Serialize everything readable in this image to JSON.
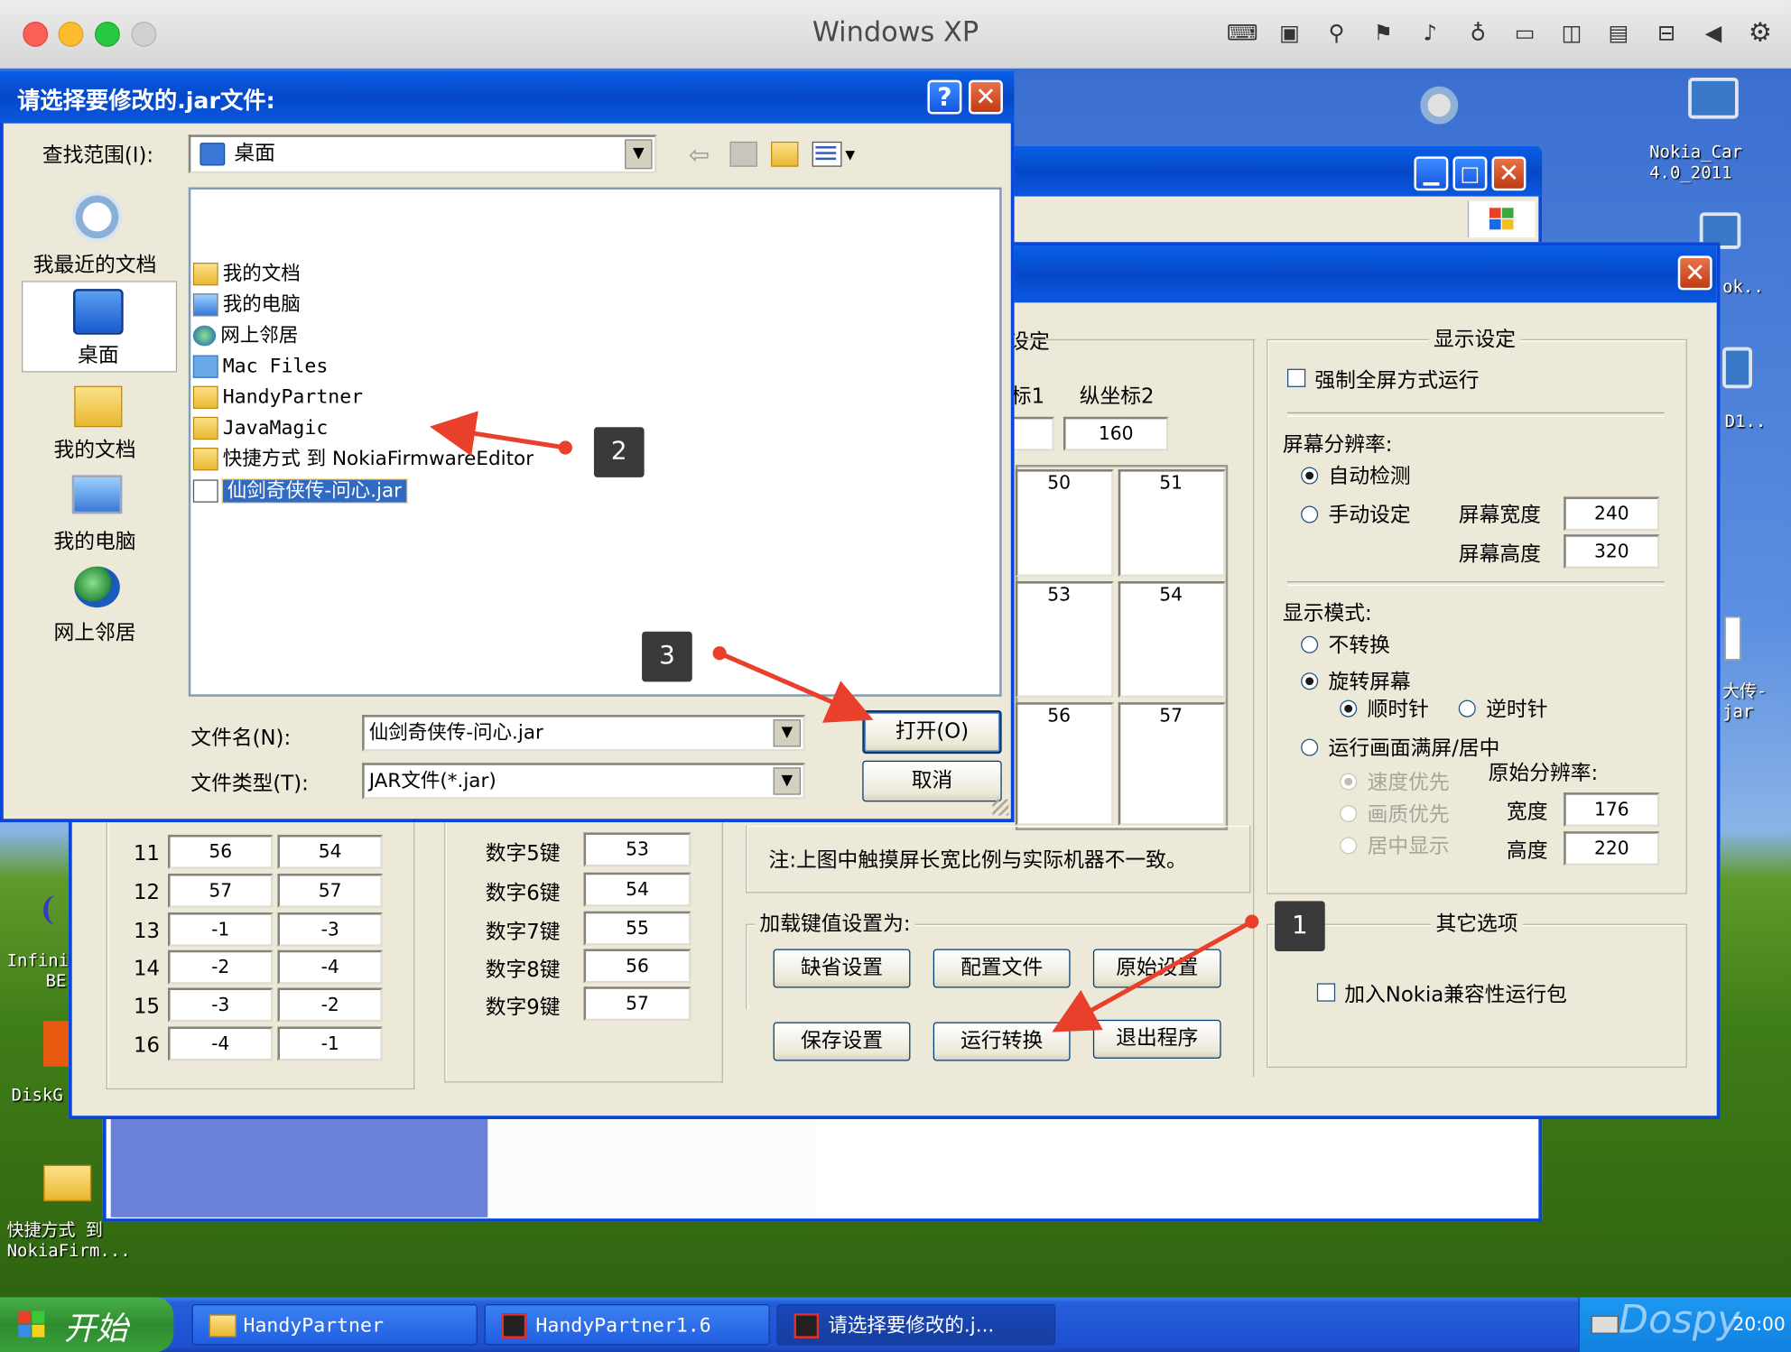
{
  "mac": {
    "title": "Windows XP",
    "status_icons": [
      "keyboard-icon",
      "cpu-icon",
      "usb-icon",
      "network-icon",
      "volume-icon",
      "microphone-icon",
      "drive-icon",
      "camera-icon",
      "display-icon",
      "folder-share-icon",
      "arrow-left-icon",
      "gear-icon"
    ]
  },
  "desktop": {
    "icons": [
      {
        "label_l1": "Nokia_Car",
        "label_l2": "4.0_2011"
      },
      {
        "label_l1": "ok..",
        "label_l2": ""
      },
      {
        "label_l1": "D1..",
        "label_l2": ""
      },
      {
        "label_l1": "大传-",
        "label_l2": "jar"
      },
      {
        "label_l1": "Infini",
        "label_l2": "BE"
      },
      {
        "label_l1": "DiskG",
        "label_l2": ""
      },
      {
        "label_l1": "快捷方式 到",
        "label_l2": "NokiaFirm..."
      }
    ]
  },
  "dialog": {
    "title": "请选择要修改的.jar文件:",
    "help_button": "?",
    "close_button": "✕",
    "look_in_label": "查找范围(I):",
    "look_in_value": "桌面",
    "places": [
      {
        "label": "我最近的文档"
      },
      {
        "label": "桌面"
      },
      {
        "label": "我的文档"
      },
      {
        "label": "我的电脑"
      },
      {
        "label": "网上邻居"
      }
    ],
    "files": [
      {
        "name": "我的文档"
      },
      {
        "name": "我的电脑"
      },
      {
        "name": "网上邻居"
      },
      {
        "name": "Mac Files"
      },
      {
        "name": "HandyPartner"
      },
      {
        "name": "JavaMagic"
      },
      {
        "name": "快捷方式 到 NokiaFirmwareEditor"
      },
      {
        "name": "仙剑奇侠传-问心.jar"
      }
    ],
    "filename_label": "文件名(N):",
    "filename_value": "仙剑奇侠传-问心.jar",
    "filetype_label": "文件类型(T):",
    "filetype_value": "JAR文件(*.jar)",
    "open_button": "打开(O)",
    "cancel_button": "取消"
  },
  "app": {
    "touch_group_title": "设定",
    "col1_header": "标1",
    "col2_header": "纵坐标2",
    "col2_value": "160",
    "grid": [
      "50",
      "51",
      "53",
      "54",
      "56",
      "57"
    ],
    "rows": [
      {
        "n": "11",
        "a": "56",
        "b": "54"
      },
      {
        "n": "12",
        "a": "57",
        "b": "57"
      },
      {
        "n": "13",
        "a": "-1",
        "b": "-3"
      },
      {
        "n": "14",
        "a": "-2",
        "b": "-4"
      },
      {
        "n": "15",
        "a": "-3",
        "b": "-2"
      },
      {
        "n": "16",
        "a": "-4",
        "b": "-1"
      }
    ],
    "keys": [
      {
        "label": "数字5键",
        "value": "53"
      },
      {
        "label": "数字6键",
        "value": "54"
      },
      {
        "label": "数字7键",
        "value": "55"
      },
      {
        "label": "数字8键",
        "value": "56"
      },
      {
        "label": "数字9键",
        "value": "57"
      }
    ],
    "note": "注:上图中触摸屏长宽比例与实际机器不一致。",
    "load_keys_title": "加载键值设置为:",
    "btn_default": "缺省设置",
    "btn_config": "配置文件",
    "btn_original": "原始设置",
    "btn_save": "保存设置",
    "btn_run": "运行转换",
    "btn_exit": "退出程序",
    "display": {
      "title": "显示设定",
      "force_fullscreen": "强制全屏方式运行",
      "resolution_label": "屏幕分辨率:",
      "auto_detect": "自动检测",
      "manual": "手动设定",
      "width_label": "屏幕宽度",
      "width_value": "240",
      "height_label": "屏幕高度",
      "height_value": "320",
      "mode_label": "显示模式:",
      "no_convert": "不转换",
      "rotate": "旋转屏幕",
      "clockwise": "顺时针",
      "counter": "逆时针",
      "fit_center": "运行画面满屏/居中",
      "speed_first": "速度优先",
      "quality_first": "画质优先",
      "center_show": "居中显示",
      "orig_res_label": "原始分辨率:",
      "orig_w_label": "宽度",
      "orig_w_value": "176",
      "orig_h_label": "高度",
      "orig_h_value": "220"
    },
    "other": {
      "title": "其它选项",
      "nokia_pack": "加入Nokia兼容性运行包"
    }
  },
  "callouts": {
    "c1": "1",
    "c2": "2",
    "c3": "3"
  },
  "taskbar": {
    "start": "开始",
    "items": [
      {
        "label": "HandyPartner"
      },
      {
        "label": "HandyPartner1.6"
      },
      {
        "label": "请选择要修改的.j..."
      }
    ],
    "clock": "20:00",
    "watermark": "Dospy"
  },
  "colors": {
    "xp_blue": "#0a46d8",
    "xp_face": "#ece9d8",
    "arrow_red": "#e8402a",
    "selection": "#316ac5"
  }
}
